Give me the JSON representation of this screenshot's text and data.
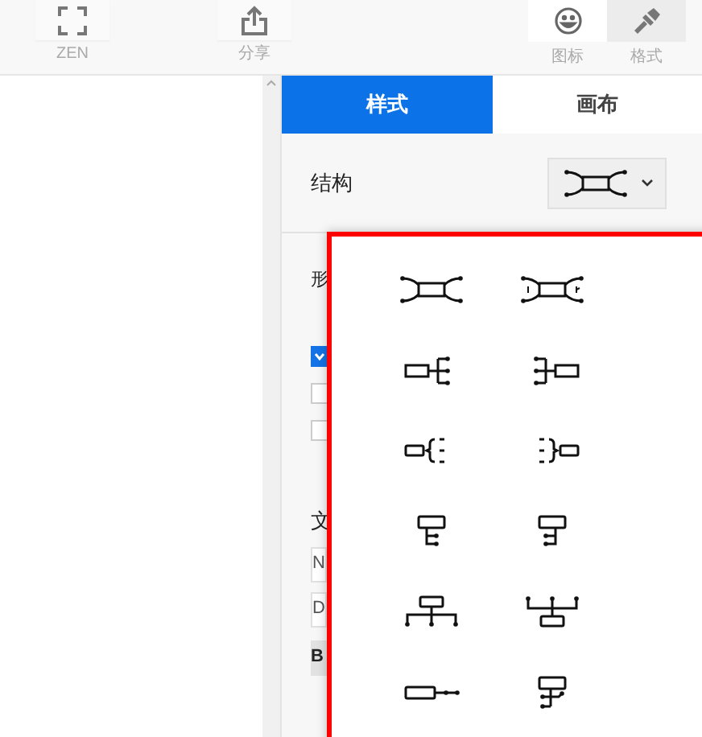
{
  "toolbar": {
    "left": [
      {
        "kind": "fullscreen",
        "label": "ZEN"
      },
      {
        "kind": "share",
        "label": "分享"
      }
    ],
    "right": [
      {
        "kind": "smiley",
        "label": "图标",
        "selected": false
      },
      {
        "kind": "brush",
        "label": "格式",
        "selected": true
      }
    ]
  },
  "panel_tabs": [
    {
      "label": "样式",
      "selected": true
    },
    {
      "label": "画布",
      "selected": false
    }
  ],
  "structure": {
    "label": "结构",
    "kind": "map"
  },
  "hidden_rows": {
    "shape_label": "形",
    "checkboxes": [
      {
        "checked": true
      },
      {
        "checked": false
      },
      {
        "checked": false
      }
    ],
    "text_label": "文",
    "fields": [
      "N",
      "D"
    ],
    "button": "B"
  },
  "structure_menu": [
    {
      "kind": "map"
    },
    {
      "kind": "map-numbered"
    },
    {
      "kind": "logic-right"
    },
    {
      "kind": "logic-left"
    },
    {
      "kind": "brace-right"
    },
    {
      "kind": "brace-left"
    },
    {
      "kind": "tree-right"
    },
    {
      "kind": "tree-left"
    },
    {
      "kind": "org-down"
    },
    {
      "kind": "org-up"
    },
    {
      "kind": "timeline"
    },
    {
      "kind": "tree-both"
    }
  ]
}
